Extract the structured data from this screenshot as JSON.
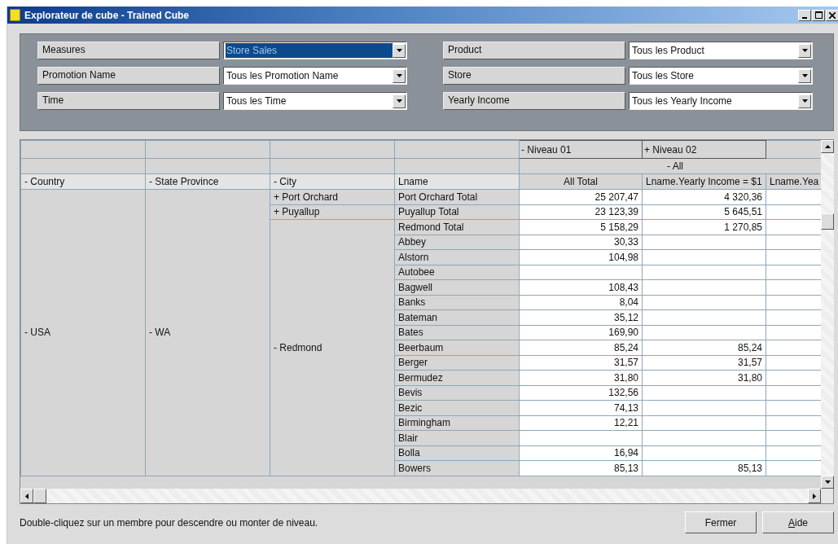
{
  "window": {
    "title": "Explorateur de cube - Trained Cube"
  },
  "filters": [
    {
      "label": "Measures",
      "value": "Store Sales",
      "focused": true
    },
    {
      "label": "Promotion Name",
      "value": "Tous les Promotion Name",
      "focused": false
    },
    {
      "label": "Time",
      "value": "Tous les Time",
      "focused": false
    },
    {
      "label": "Product",
      "value": "Tous les Product",
      "focused": false
    },
    {
      "label": "Store",
      "value": "Tous les Store",
      "focused": false
    },
    {
      "label": "Yearly Income",
      "value": "Tous les Yearly Income",
      "focused": false
    }
  ],
  "grid": {
    "levels": [
      "- Niveau 01",
      "+ Niveau 02"
    ],
    "member": "- All",
    "row_headers": [
      "- Country",
      "- State Province",
      "- City",
      "Lname"
    ],
    "column_headers": [
      "All Total",
      "Lname.Yearly Income = $1",
      "Lname.Yea"
    ],
    "country": "- USA",
    "state": "- WA",
    "cities": [
      {
        "label": "+ Port Orchard",
        "rows": [
          {
            "name": "Port Orchard Total",
            "all_total": "25 207,47",
            "income_1": "4 320,36"
          }
        ]
      },
      {
        "label": "+ Puyallup",
        "rows": [
          {
            "name": "Puyallup Total",
            "all_total": "23 123,39",
            "income_1": "5 645,51"
          }
        ]
      },
      {
        "label": "- Redmond",
        "rows": [
          {
            "name": "Redmond Total",
            "all_total": "5 158,29",
            "income_1": "1 270,85"
          },
          {
            "name": "Abbey",
            "all_total": "30,33"
          },
          {
            "name": "Alstorn",
            "all_total": "104,98"
          },
          {
            "name": "Autobee"
          },
          {
            "name": "Bagwell",
            "all_total": "108,43"
          },
          {
            "name": "Banks",
            "all_total": "8,04"
          },
          {
            "name": "Bateman",
            "all_total": "35,12"
          },
          {
            "name": "Bates",
            "all_total": "169,90"
          },
          {
            "name": "Beerbaum",
            "all_total": "85,24",
            "income_1": "85,24"
          },
          {
            "name": "Berger",
            "all_total": "31,57",
            "income_1": "31,57"
          },
          {
            "name": "Bermudez",
            "all_total": "31,80",
            "income_1": "31,80"
          },
          {
            "name": "Bevis",
            "all_total": "132,56"
          },
          {
            "name": "Bezic",
            "all_total": "74,13"
          },
          {
            "name": "Birmingham",
            "all_total": "12,21"
          },
          {
            "name": "Blair"
          },
          {
            "name": "Bolla",
            "all_total": "16,94"
          },
          {
            "name": "Bowers",
            "all_total": "85,13",
            "income_1": "85,13"
          }
        ]
      }
    ]
  },
  "status_text": "Double-cliquez sur un membre pour descendre ou monter de niveau.",
  "buttons": [
    {
      "label": "Fermer",
      "mnemonic": false
    },
    {
      "label": "Aide",
      "mnemonic": true
    }
  ]
}
